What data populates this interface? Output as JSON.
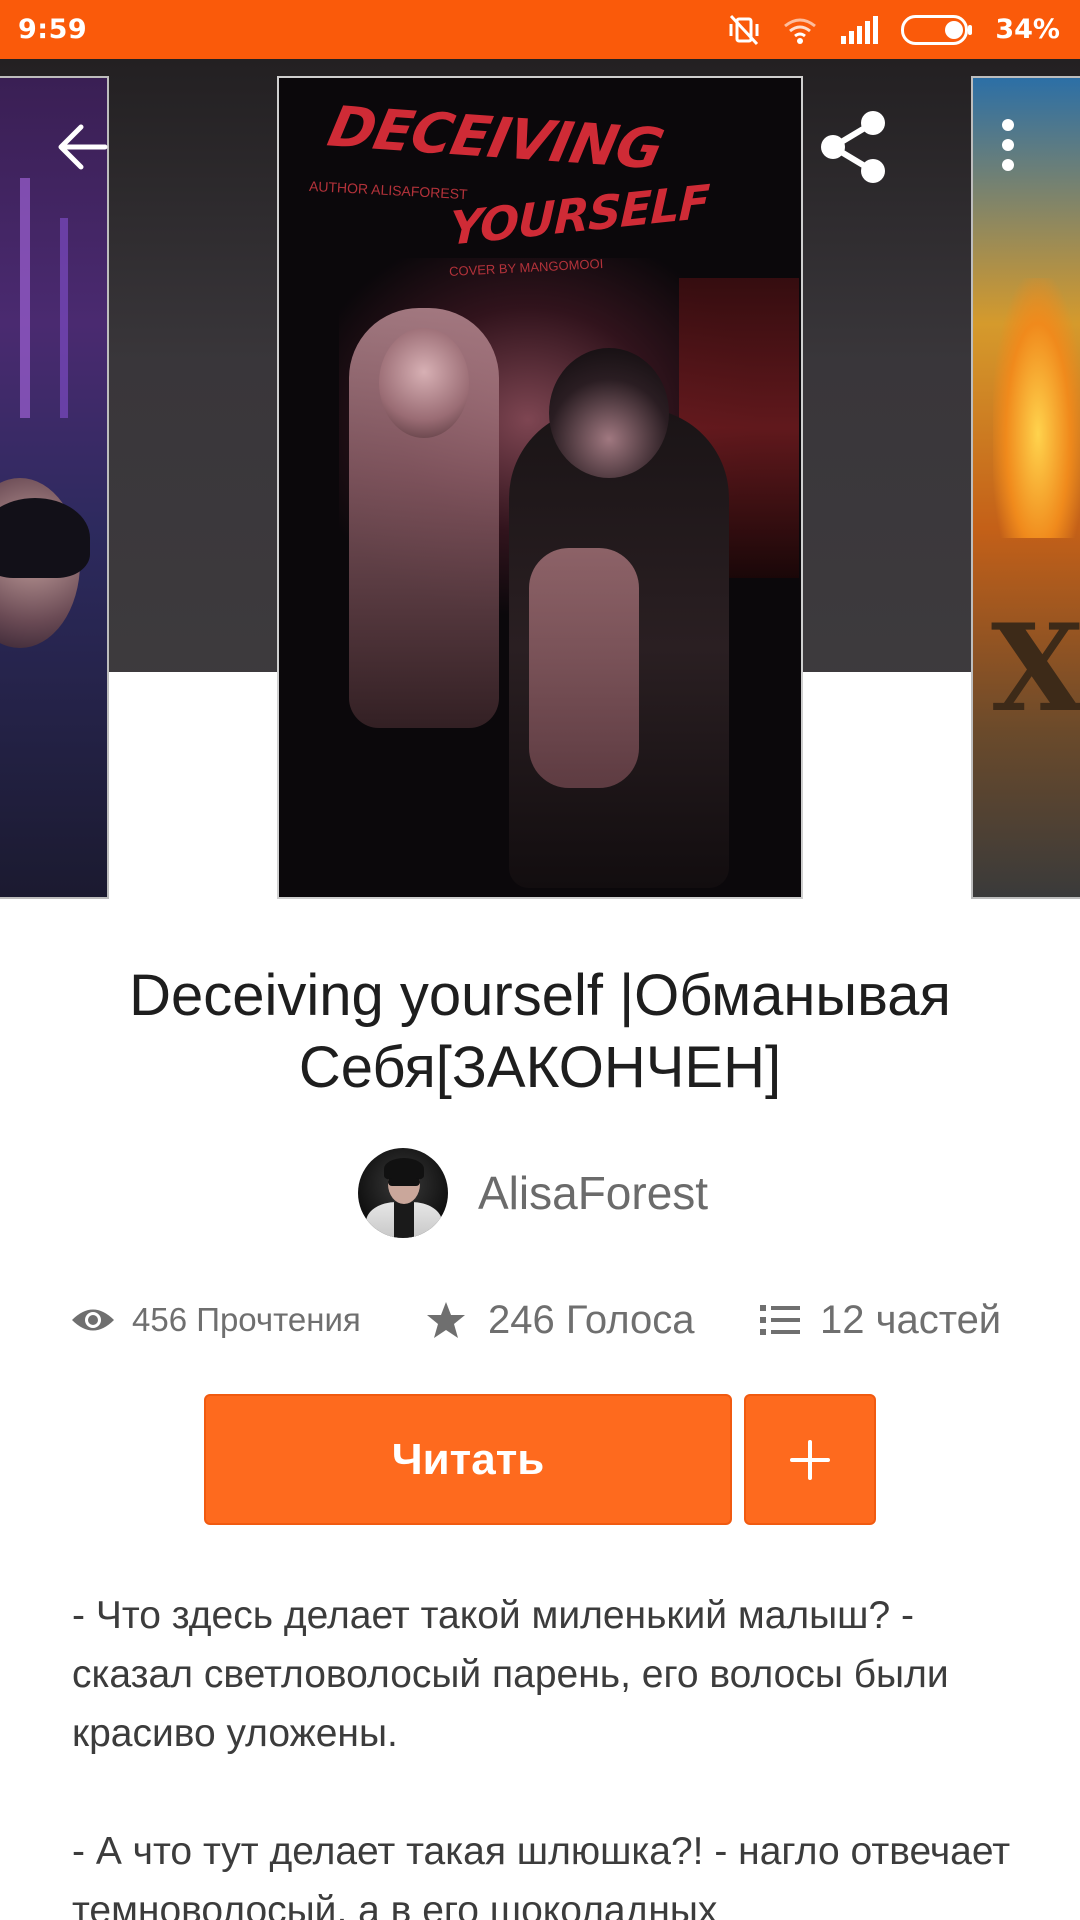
{
  "status_bar": {
    "time": "9:59",
    "battery_percent": "34%",
    "battery_level": 0.34,
    "icons": [
      "mute-vibrate-icon",
      "wifi-icon",
      "signal-icon",
      "battery-icon"
    ]
  },
  "header": {
    "back_icon": "back-arrow-icon",
    "share_icon": "share-icon",
    "menu_icon": "more-vertical-icon"
  },
  "cover": {
    "title_line1": "DECEIVING",
    "title_line2": "YOURSELF",
    "author_text": "AUTHOR ALISAFOREST",
    "credit_text": "COVER BY MANGOMOOI"
  },
  "story": {
    "title": "Deceiving yourself |Обманывая Себя[ЗАКОНЧЕН]",
    "author": "AlisaForest"
  },
  "stats": {
    "reads": "456 Прочтения",
    "votes": "246 Голоса",
    "parts": "12 частей"
  },
  "actions": {
    "read_label": "Читать",
    "add_icon": "plus-icon"
  },
  "description": {
    "paragraph1": "- Что здесь делает такой миленький малыш? - сказал светловолосый парень, его волосы были красиво уложены.",
    "paragraph2": "- А что тут делает такая шлюшка?! - нагло отвечает темноволосый, а в его шоколадных"
  },
  "colors": {
    "accent": "#fa5a0a",
    "button": "#fe6a1e",
    "text_dark": "#1e1e1e",
    "text_muted": "#6f6f6f"
  }
}
